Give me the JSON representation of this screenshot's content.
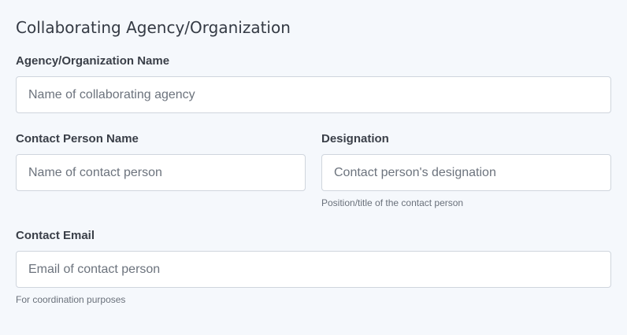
{
  "section": {
    "title": "Collaborating Agency/Organization"
  },
  "agency_name": {
    "label": "Agency/Organization Name",
    "value": "",
    "placeholder": "Name of collaborating agency"
  },
  "contact_person": {
    "label": "Contact Person Name",
    "value": "",
    "placeholder": "Name of contact person"
  },
  "designation": {
    "label": "Designation",
    "value": "",
    "placeholder": "Contact person's designation",
    "help": "Position/title of the contact person"
  },
  "contact_email": {
    "label": "Contact Email",
    "value": "",
    "placeholder": "Email of contact person",
    "help": "For coordination purposes"
  },
  "colors": {
    "background": "#f5f8fc",
    "input_border": "#cfd5dd",
    "label_text": "#3a3f48",
    "help_text": "#6a717b"
  }
}
